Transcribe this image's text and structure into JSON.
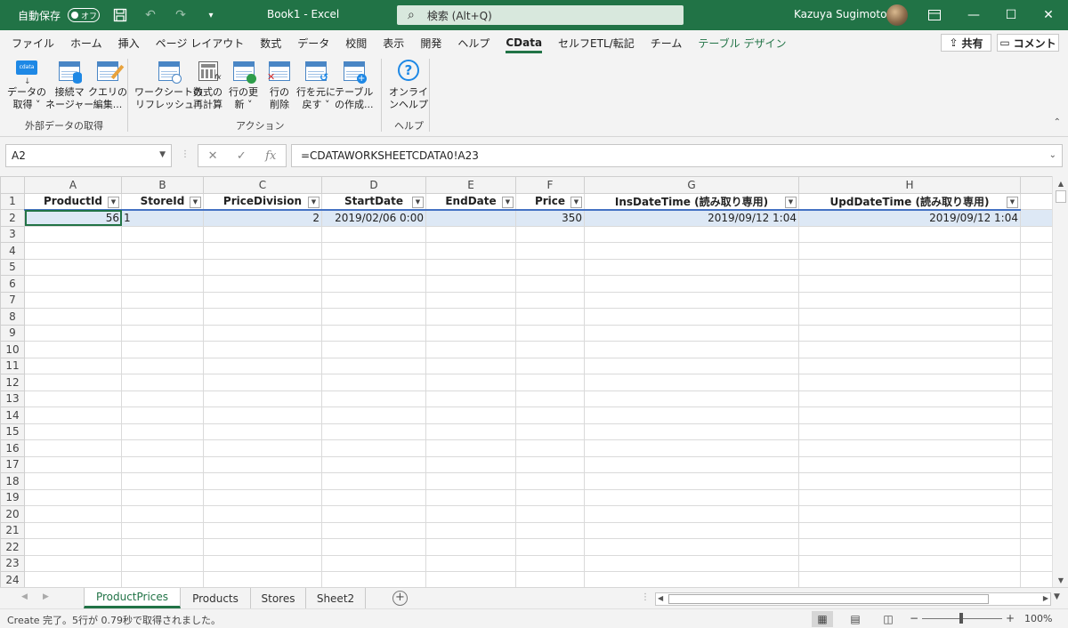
{
  "titlebar": {
    "autosave_label": "自動保存",
    "autosave_state": "オフ",
    "doc_title": "Book1  -  Excel",
    "search_placeholder": "検索 (Alt+Q)",
    "user_name": "Kazuya Sugimoto"
  },
  "ribbon_tabs": [
    "ファイル",
    "ホーム",
    "挿入",
    "ページ レイアウト",
    "数式",
    "データ",
    "校閲",
    "表示",
    "開発",
    "ヘルプ",
    "CData",
    "セルフETL/転記",
    "チーム",
    "テーブル デザイン"
  ],
  "active_tab": "CData",
  "share_label": "共有",
  "comment_label": "コメント",
  "ribbon": {
    "buttons": [
      {
        "line1": "データの",
        "line2": "取得 ˅",
        "icon": "cdata-get-data-icon"
      },
      {
        "line1": "接続マ",
        "line2": "ネージャー",
        "icon": "connection-manager-icon"
      },
      {
        "line1": "クエリの",
        "line2": "編集...",
        "icon": "edit-query-icon"
      },
      {
        "line1": "ワークシートの",
        "line2": "リフレッシュ ˅",
        "icon": "refresh-sheet-icon"
      },
      {
        "line1": "数式の",
        "line2": "再計算",
        "icon": "recalculate-icon"
      },
      {
        "line1": "行の更",
        "line2": "新 ˅",
        "icon": "update-rows-icon"
      },
      {
        "line1": "行の",
        "line2": "削除",
        "icon": "delete-rows-icon"
      },
      {
        "line1": "行を元に",
        "line2": "戻す ˅",
        "icon": "revert-rows-icon"
      },
      {
        "line1": "テーブル",
        "line2": "の作成...",
        "icon": "create-table-icon"
      },
      {
        "line1": "オンライ",
        "line2": "ンヘルプ",
        "icon": "help-icon"
      }
    ],
    "groups": [
      "外部データの取得",
      "アクション",
      "ヘルプ"
    ]
  },
  "formula_bar": {
    "name_box": "A2",
    "formula": "=CDATAWORKSHEETCDATA0!A23"
  },
  "grid": {
    "columns": [
      "A",
      "B",
      "C",
      "D",
      "E",
      "F",
      "G",
      "H"
    ],
    "headers": [
      "ProductId",
      "StoreId",
      "PriceDivision",
      "StartDate",
      "EndDate",
      "Price",
      "InsDateTime (読み取り専用)",
      "UpdDateTime (読み取り専用)"
    ],
    "row2": [
      "56",
      "1",
      "2",
      "2019/02/06 0:00",
      "",
      "350",
      "2019/09/12 1:04",
      "2019/09/12 1:04"
    ],
    "row_numbers": [
      "1",
      "2",
      "3",
      "4",
      "5",
      "6",
      "7",
      "8",
      "9",
      "10",
      "11",
      "12",
      "13",
      "14",
      "15",
      "16",
      "17",
      "18",
      "19",
      "20",
      "21",
      "22",
      "23",
      "24"
    ]
  },
  "sheets": [
    "ProductPrices",
    "Products",
    "Stores",
    "Sheet2"
  ],
  "active_sheet": "ProductPrices",
  "status": {
    "message": "Create 完了。5行が 0.79秒で取得されました。",
    "zoom": "100%"
  },
  "colors": {
    "excel_green": "#217346",
    "table_header_border": "#4472c4",
    "selected_row_fill": "#dde8f5"
  }
}
